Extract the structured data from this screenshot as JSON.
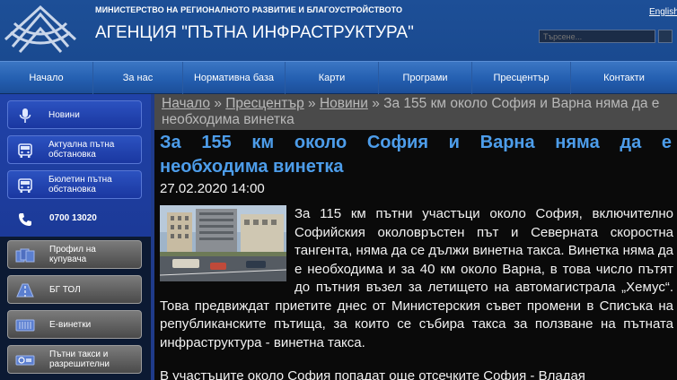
{
  "header": {
    "ministry": "МИНИСТЕРСТВО НА РЕГИОНАЛНОТО РАЗВИТИЕ И БЛАГОУСТРОЙСТВОТО",
    "agency": "АГЕНЦИЯ \"ПЪТНА ИНФРАСТРУКТУРА\"",
    "lang_link": "English",
    "search_placeholder": "Търсене..."
  },
  "nav": [
    "Начало",
    "За нас",
    "Нормативна база",
    "Карти",
    "Програми",
    "Пресцентър",
    "Контакти"
  ],
  "sidebar": {
    "blue_items": [
      {
        "label": "Новини",
        "icon": "microphone-icon"
      },
      {
        "label": "Актуална пътна обстановка",
        "icon": "bus-icon"
      },
      {
        "label": "Бюлетин пътна обстановка",
        "icon": "bus-icon"
      }
    ],
    "phone": {
      "label": "0700 13020",
      "icon": "phone-icon"
    },
    "gray_items": [
      {
        "label": "Профил на купувача",
        "icon": "documents-icon"
      },
      {
        "label": "БГ ТОЛ",
        "icon": "road-icon"
      },
      {
        "label": "Е-винетки",
        "icon": "ticket-icon"
      },
      {
        "label": "Пътни такси и разрешителни",
        "icon": "toll-icon"
      }
    ]
  },
  "breadcrumb": {
    "items": [
      "Начало",
      "Пресцентър",
      "Новини"
    ],
    "separator": "»",
    "current": "За 155 км около София и Варна няма да е необходима винетка"
  },
  "article": {
    "title": "За 155 км около София и Варна няма да е необходима винетка",
    "title_line1": "За 155 км около София и Варна няма да е",
    "title_line2": "необходима винетка",
    "date": "27.02.2020 14:00",
    "body": "За 115 км пътни участъци около София, включително Софийския околовръстен път и Северната скоростна тангента, няма да се дължи винетна такса. Винетка няма да е необходима и за 40 км около Варна, в това число пътят до пътния възел за летището на автомагистрала „Хемус“. Това предвиждат приетите днес от Министерския съвет промени в Списъка на републиканските пътища, за които се събира такса за ползване на пътната инфраструктура - винетна такса.",
    "body2": "В участъците около София попадат още отсечките София - Владая"
  },
  "colors": {
    "header_blue": "#1d4f97",
    "title_blue": "#4d9dea",
    "sidebar_blue": "#2042a8"
  }
}
